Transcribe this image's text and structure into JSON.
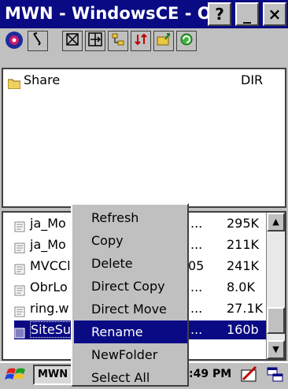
{
  "window": {
    "title": "MWN - WindowsCE - O..."
  },
  "titlebar_buttons": {
    "help": "?",
    "minimize": "_",
    "close": "×"
  },
  "toolbar": {
    "icons": [
      "mwn-logo-icon",
      "find-icon",
      "select-icon",
      "expand-icon",
      "tree-icon",
      "sort-icon",
      "folder-up-icon",
      "refresh-icon"
    ]
  },
  "top_pane": {
    "items": [
      {
        "name": "Share",
        "type": "DIR"
      }
    ]
  },
  "bottom_pane": {
    "items": [
      {
        "name": "ja_Mo",
        "mid": "...",
        "size": "295K"
      },
      {
        "name": "ja_Mo",
        "mid": "...",
        "size": "211K"
      },
      {
        "name": "MVCCl",
        "mid": "05",
        "size": "241K"
      },
      {
        "name": "ObrLo",
        "mid": "...",
        "size": "8.0K"
      },
      {
        "name": "ring.w",
        "mid": "...",
        "size": "27.1K"
      },
      {
        "name": "SiteSu",
        "mid": "...",
        "size": "160b"
      }
    ]
  },
  "context_menu": {
    "items": [
      "Refresh",
      "Copy",
      "Delete",
      "Direct Copy",
      "Direct Move",
      "Rename",
      "NewFolder",
      "Select All"
    ],
    "selected_index": 5
  },
  "taskbar": {
    "app_label": "MWN",
    "clock": ":49 PM"
  }
}
